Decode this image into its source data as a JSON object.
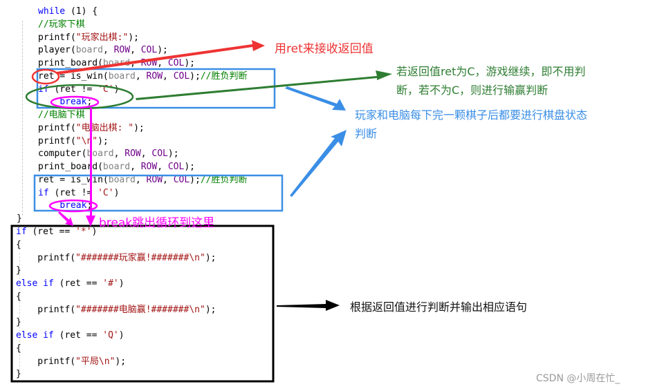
{
  "code": {
    "loop_lines": [
      {
        "id": "while",
        "parts": [
          [
            "kw",
            "while"
          ],
          [
            "fn",
            " (1) {"
          ]
        ]
      },
      {
        "id": "cmt-player",
        "parts": [
          [
            "cmt",
            "//玩家下棋"
          ]
        ]
      },
      {
        "id": "printf-player",
        "parts": [
          [
            "fn",
            "printf("
          ],
          [
            "str",
            "\"玩家出棋:\""
          ],
          [
            "fn",
            ");"
          ]
        ]
      },
      {
        "id": "player-call",
        "parts": [
          [
            "fn",
            "player("
          ],
          [
            "param",
            "board"
          ],
          [
            "fn",
            ", "
          ],
          [
            "mac",
            "ROW"
          ],
          [
            "fn",
            ", "
          ],
          [
            "mac",
            "COL"
          ],
          [
            "fn",
            ");"
          ]
        ]
      },
      {
        "id": "print-board-1",
        "parts": [
          [
            "fn",
            "print_board("
          ],
          [
            "param",
            "board"
          ],
          [
            "fn",
            ", "
          ],
          [
            "mac",
            "ROW"
          ],
          [
            "fn",
            ", "
          ],
          [
            "mac",
            "COL"
          ],
          [
            "fn",
            ");"
          ]
        ]
      },
      {
        "id": "is-win-1",
        "parts": [
          [
            "fn",
            "ret = is_win("
          ],
          [
            "param",
            "board"
          ],
          [
            "fn",
            ", "
          ],
          [
            "mac",
            "ROW"
          ],
          [
            "fn",
            ", "
          ],
          [
            "mac",
            "COL"
          ],
          [
            "fn",
            ");"
          ],
          [
            "cmt",
            "//胜负判断"
          ]
        ]
      },
      {
        "id": "if-1",
        "parts": [
          [
            "kw",
            "if"
          ],
          [
            "fn",
            " (ret != "
          ],
          [
            "str",
            "'C'"
          ],
          [
            "fn",
            ")"
          ]
        ]
      },
      {
        "id": "break-1",
        "parts": [
          [
            "fn",
            "    "
          ],
          [
            "kw",
            "break"
          ],
          [
            "fn",
            ";"
          ]
        ]
      },
      {
        "id": "cmt-computer",
        "parts": [
          [
            "cmt",
            "//电脑下棋"
          ]
        ]
      },
      {
        "id": "printf-computer",
        "parts": [
          [
            "fn",
            "printf("
          ],
          [
            "str",
            "\"电脑出棋: \""
          ],
          [
            "fn",
            ");"
          ]
        ]
      },
      {
        "id": "printf-newline",
        "parts": [
          [
            "fn",
            "printf("
          ],
          [
            "str",
            "\"\\n\""
          ],
          [
            "fn",
            ");"
          ]
        ]
      },
      {
        "id": "computer-call",
        "parts": [
          [
            "fn",
            "computer("
          ],
          [
            "param",
            "board"
          ],
          [
            "fn",
            ", "
          ],
          [
            "mac",
            "ROW"
          ],
          [
            "fn",
            ", "
          ],
          [
            "mac",
            "COL"
          ],
          [
            "fn",
            ");"
          ]
        ]
      },
      {
        "id": "print-board-2",
        "parts": [
          [
            "fn",
            "print_board("
          ],
          [
            "param",
            "board"
          ],
          [
            "fn",
            ", "
          ],
          [
            "mac",
            "ROW"
          ],
          [
            "fn",
            ", "
          ],
          [
            "mac",
            "COL"
          ],
          [
            "fn",
            ");"
          ]
        ]
      },
      {
        "id": "is-win-2",
        "parts": [
          [
            "fn",
            "ret = is_win("
          ],
          [
            "param",
            "board"
          ],
          [
            "fn",
            ", "
          ],
          [
            "mac",
            "ROW"
          ],
          [
            "fn",
            ", "
          ],
          [
            "mac",
            "COL"
          ],
          [
            "fn",
            ");"
          ],
          [
            "cmt",
            "//胜负判断"
          ]
        ]
      },
      {
        "id": "if-2",
        "parts": [
          [
            "kw",
            "if"
          ],
          [
            "fn",
            " (ret != "
          ],
          [
            "str",
            "'C'"
          ],
          [
            "fn",
            ")"
          ]
        ]
      },
      {
        "id": "break-2",
        "parts": [
          [
            "fn",
            "    "
          ],
          [
            "kw",
            "break"
          ],
          [
            "fn",
            ";"
          ]
        ]
      }
    ],
    "close_brace": "}",
    "result_lines": [
      {
        "id": "if-star",
        "parts": [
          [
            "kw",
            "if"
          ],
          [
            "fn",
            " (ret == "
          ],
          [
            "str",
            "'*'"
          ],
          [
            "fn",
            ")"
          ]
        ]
      },
      {
        "id": "brace-open-1",
        "parts": [
          [
            "fn",
            "{"
          ]
        ]
      },
      {
        "id": "printf-player-win",
        "parts": [
          [
            "fn",
            "    printf("
          ],
          [
            "str",
            "\"#######玩家赢!#######\\n\""
          ],
          [
            "fn",
            ");"
          ]
        ]
      },
      {
        "id": "brace-close-1",
        "parts": [
          [
            "fn",
            "}"
          ]
        ]
      },
      {
        "id": "elseif-hash",
        "parts": [
          [
            "kw",
            "else if"
          ],
          [
            "fn",
            " (ret == "
          ],
          [
            "str",
            "'#'"
          ],
          [
            "fn",
            ")"
          ]
        ]
      },
      {
        "id": "brace-open-2",
        "parts": [
          [
            "fn",
            "{"
          ]
        ]
      },
      {
        "id": "printf-computer-win",
        "parts": [
          [
            "fn",
            "    printf("
          ],
          [
            "str",
            "\"#######电脑赢!#######\\n\""
          ],
          [
            "fn",
            ");"
          ]
        ]
      },
      {
        "id": "brace-close-2",
        "parts": [
          [
            "fn",
            "}"
          ]
        ]
      },
      {
        "id": "elseif-q",
        "parts": [
          [
            "kw",
            "else if"
          ],
          [
            "fn",
            " (ret == "
          ],
          [
            "str",
            "'Q'"
          ],
          [
            "fn",
            ")"
          ]
        ]
      },
      {
        "id": "brace-open-3",
        "parts": [
          [
            "fn",
            "{"
          ]
        ]
      },
      {
        "id": "printf-draw",
        "parts": [
          [
            "fn",
            "    printf("
          ],
          [
            "str",
            "\"平局\\n\""
          ],
          [
            "fn",
            ");"
          ]
        ]
      },
      {
        "id": "brace-close-3",
        "parts": [
          [
            "fn",
            "}"
          ]
        ]
      }
    ]
  },
  "annotations": {
    "ret_receive": "用ret来接收返回值",
    "continue_check_line1": "若返回值ret为C，游戏继续，即不用判",
    "continue_check_line2": "断，若不为C，则进行输赢判断",
    "board_state_line1": "玩家和电脑每下完一颗棋子后都要进行棋盘状态",
    "board_state_line2": "判断",
    "break_jump": "break跳出循环到这里",
    "result_output": "根据返回值进行判断并输出相应语句"
  },
  "colors": {
    "red": "#ee3333",
    "green": "#2e7d32",
    "blue": "#3a8ee6",
    "magenta": "#ff00ff",
    "black": "#000000"
  },
  "watermark": "CSDN @小周在忙_"
}
